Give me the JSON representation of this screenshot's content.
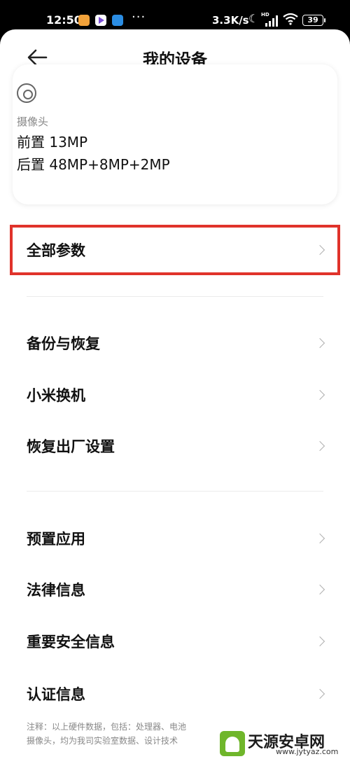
{
  "status_bar": {
    "time": "12:50",
    "more": "···",
    "net_speed": "3.3K/s",
    "hd_label": "HD",
    "battery": "39"
  },
  "header": {
    "title": "我的设备"
  },
  "camera_card": {
    "label": "摄像头",
    "front": "前置 13MP",
    "rear": "后置 48MP+8MP+2MP"
  },
  "all_params": {
    "label": "全部参数"
  },
  "group1": [
    {
      "label": "备份与恢复"
    },
    {
      "label": "小米换机"
    },
    {
      "label": "恢复出厂设置"
    }
  ],
  "group2": [
    {
      "label": "预置应用"
    },
    {
      "label": "法律信息"
    },
    {
      "label": "重要安全信息"
    },
    {
      "label": "认证信息"
    }
  ],
  "footnote": {
    "line1": "注释：以上硬件数据，包括：处理器、电池",
    "line2": "摄像头，均为我司实验室数据、设计技术"
  },
  "watermark": {
    "title": "天源安卓网",
    "url": "www.jytyaz.com"
  },
  "colors": {
    "highlight": "#e0332b",
    "watermark_green": "#6fb62b"
  }
}
